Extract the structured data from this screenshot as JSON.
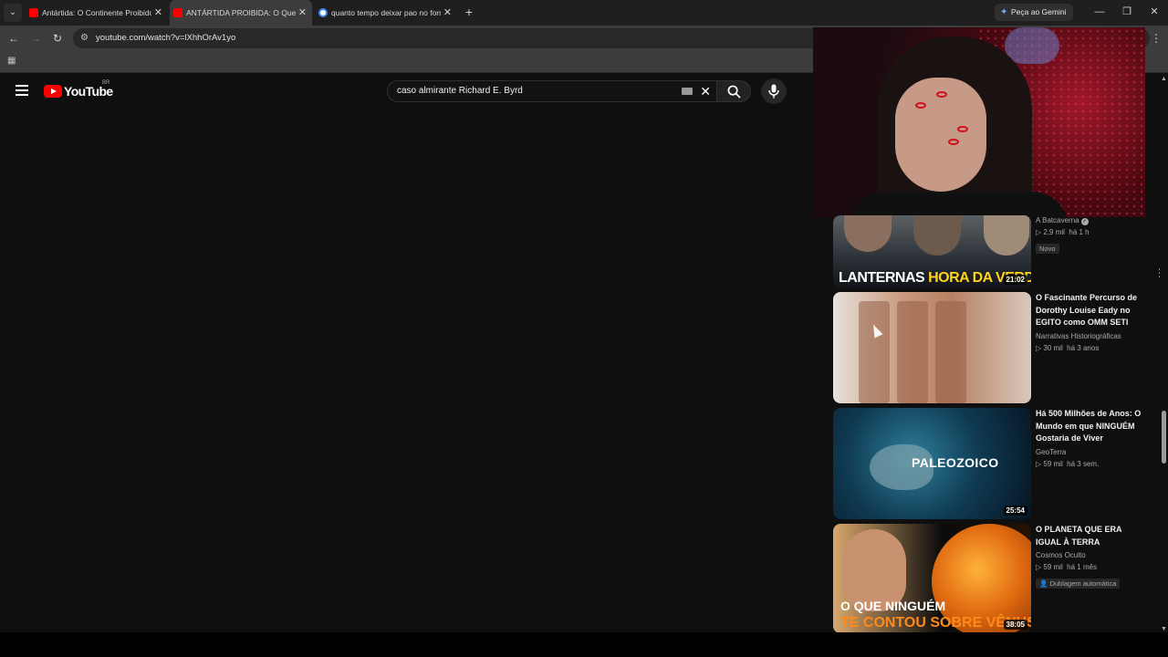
{
  "browser": {
    "tabs": [
      {
        "label": "Antártida: O Continente Proibido",
        "icon": "youtube-icon",
        "active": false
      },
      {
        "label": "ANTÁRTIDA PROIBIDA: O Que é",
        "icon": "youtube-icon",
        "active": true
      },
      {
        "label": "quanto tempo deixar pao no forno",
        "icon": "google-icon",
        "active": false
      }
    ],
    "new_tab": "+",
    "gemini_label": "Peça ao Gemini",
    "url": "youtube.com/watch?v=lXhhOrAv1yo"
  },
  "youtube": {
    "logo_text": "YouTube",
    "country_code": "BR",
    "search_query": "caso almirante Richard E. Byrd"
  },
  "related": [
    {
      "title": "",
      "thumb_text_white": "LANTERNAS ",
      "thumb_text_yellow": "HORA DA VERDADE",
      "channel": "A Batcaverna",
      "verified": true,
      "views": "▷ 2,9 mil",
      "age": "há 1 h",
      "badge": "Novo",
      "duration": "21:02"
    },
    {
      "title": "O Fascinante Percurso de Dorothy Louise Eady no EGITO como OMM SETI",
      "channel": "Narrativas Historiográficas",
      "views": "▷ 30 mil",
      "age": "há 3 anos"
    },
    {
      "title": "Há 500 Milhões de Anos: O Mundo em que NINGUÉM Gostaria de Viver",
      "thumb_text": "PALEOZOICO",
      "channel": "GeoTerra",
      "views": "▷ 59 mil",
      "age": "há 3 sem.",
      "duration": "25:54"
    },
    {
      "title": "O PLANETA QUE ERA IGUAL À TERRA",
      "thumb_line1": "O QUE NINGUÉM",
      "thumb_line2": "TE CONTOU SOBRE VÊNUS",
      "channel": "Cosmos Oculto",
      "views": "▷ 59 mil",
      "age": "há 1 mês",
      "badge": "Dublagem automática",
      "duration": "38:05"
    }
  ],
  "colors": {
    "background": "#0f0f0f",
    "brand_red": "#ff0000",
    "text_primary": "#f1f1f1",
    "text_secondary": "#aaaaaa"
  }
}
